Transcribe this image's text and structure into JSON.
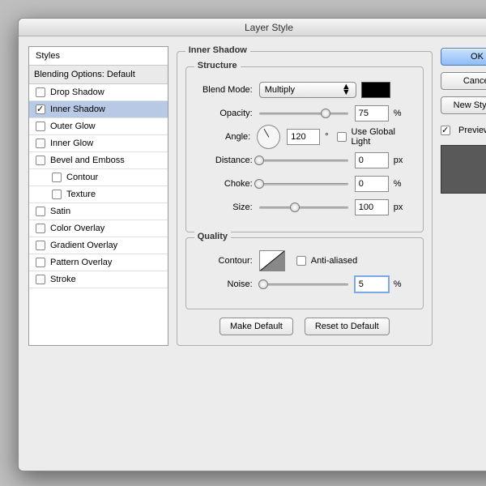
{
  "window": {
    "title": "Layer Style"
  },
  "styles": {
    "header": "Styles",
    "subheader": "Blending Options: Default",
    "items": [
      {
        "label": "Drop Shadow",
        "checked": false,
        "selected": false
      },
      {
        "label": "Inner Shadow",
        "checked": true,
        "selected": true
      },
      {
        "label": "Outer Glow",
        "checked": false,
        "selected": false
      },
      {
        "label": "Inner Glow",
        "checked": false,
        "selected": false
      },
      {
        "label": "Bevel and Emboss",
        "checked": false,
        "selected": false
      },
      {
        "label": "Contour",
        "checked": false,
        "selected": false,
        "indent": true
      },
      {
        "label": "Texture",
        "checked": false,
        "selected": false,
        "indent": true
      },
      {
        "label": "Satin",
        "checked": false,
        "selected": false
      },
      {
        "label": "Color Overlay",
        "checked": false,
        "selected": false
      },
      {
        "label": "Gradient Overlay",
        "checked": false,
        "selected": false
      },
      {
        "label": "Pattern Overlay",
        "checked": false,
        "selected": false
      },
      {
        "label": "Stroke",
        "checked": false,
        "selected": false
      }
    ]
  },
  "panel": {
    "title": "Inner Shadow",
    "structure": {
      "title": "Structure",
      "blend_mode_label": "Blend Mode:",
      "blend_mode_value": "Multiply",
      "color": "#000000",
      "opacity_label": "Opacity:",
      "opacity_value": "75",
      "opacity_unit": "%",
      "opacity_pct": 75,
      "angle_label": "Angle:",
      "angle_value": "120",
      "angle_unit": "°",
      "use_global_label": "Use Global Light",
      "use_global_checked": false,
      "distance_label": "Distance:",
      "distance_value": "0",
      "distance_unit": "px",
      "distance_pct": 0,
      "choke_label": "Choke:",
      "choke_value": "0",
      "choke_unit": "%",
      "choke_pct": 0,
      "size_label": "Size:",
      "size_value": "100",
      "size_unit": "px",
      "size_pct": 40
    },
    "quality": {
      "title": "Quality",
      "contour_label": "Contour:",
      "anti_alias_label": "Anti-aliased",
      "anti_alias_checked": false,
      "noise_label": "Noise:",
      "noise_value": "5",
      "noise_unit": "%",
      "noise_pct": 5
    },
    "buttons": {
      "make_default": "Make Default",
      "reset": "Reset to Default"
    }
  },
  "right": {
    "ok": "OK",
    "cancel": "Cancel",
    "new_style": "New Style...",
    "preview_label": "Preview",
    "preview_checked": true
  }
}
